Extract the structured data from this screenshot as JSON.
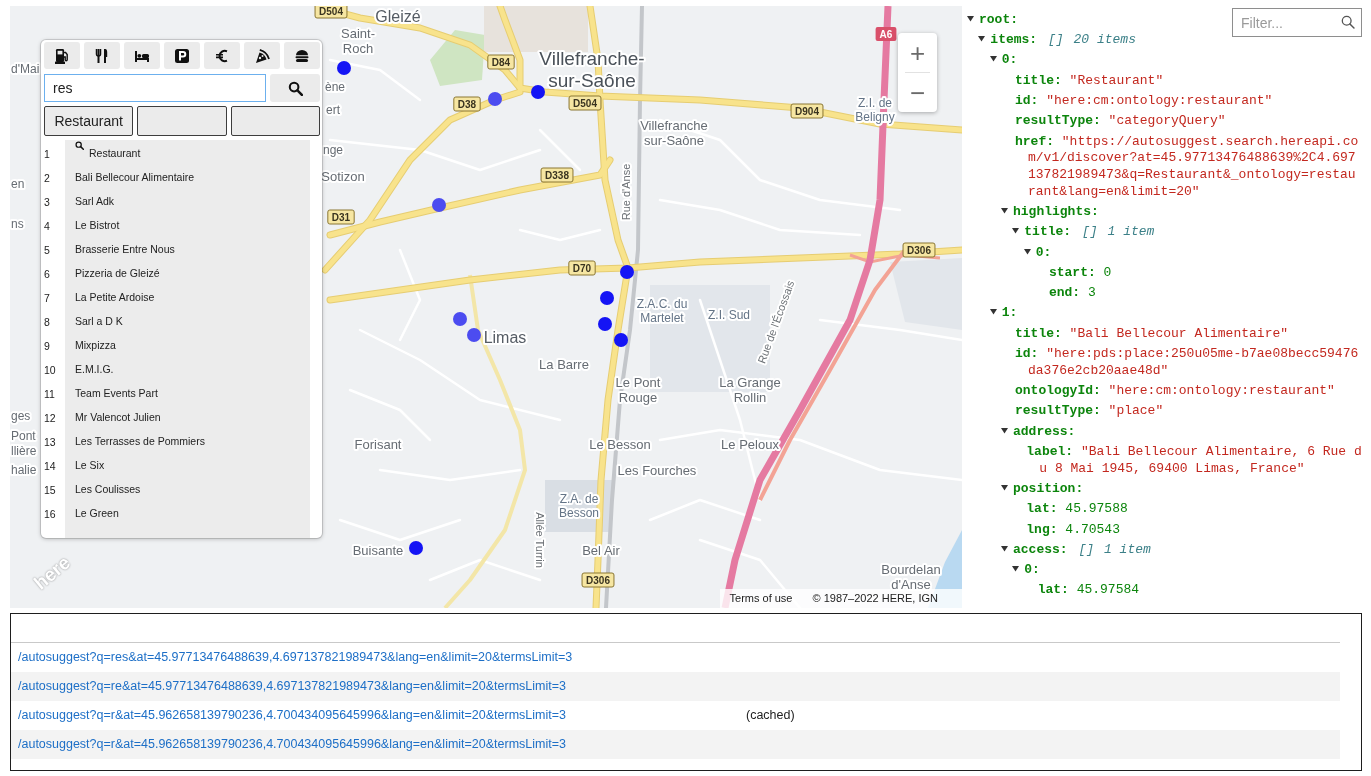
{
  "map": {
    "labels": [
      {
        "kind": "road",
        "lines": [
          "D504"
        ]
      },
      {
        "kind": "town",
        "lines": [
          "Gleizé"
        ]
      },
      {
        "kind": "place",
        "lines": [
          "Saint-",
          "Roch"
        ]
      },
      {
        "kind": "motorway",
        "lines": [
          "A6"
        ]
      },
      {
        "kind": "partial",
        "lines": [
          "d'Mai"
        ]
      },
      {
        "kind": "road",
        "lines": [
          "D84"
        ]
      },
      {
        "kind": "city",
        "lines": [
          "Villefranche-",
          "sur-Saône"
        ]
      },
      {
        "kind": "partial",
        "lines": [
          "ène"
        ]
      },
      {
        "kind": "partial",
        "lines": [
          "ert"
        ]
      },
      {
        "kind": "road",
        "lines": [
          "D38"
        ]
      },
      {
        "kind": "road",
        "lines": [
          "D504"
        ]
      },
      {
        "kind": "road",
        "lines": [
          "D904"
        ]
      },
      {
        "kind": "area",
        "lines": [
          "Z.I. de",
          "Beligny"
        ]
      },
      {
        "kind": "place",
        "lines": [
          "Villefranche",
          "sur-Saône"
        ]
      },
      {
        "kind": "partial",
        "lines": [
          "nge"
        ]
      },
      {
        "kind": "partial",
        "lines": [
          "en"
        ]
      },
      {
        "kind": "place",
        "lines": [
          "Sotizon"
        ]
      },
      {
        "kind": "road",
        "lines": [
          "D338"
        ]
      },
      {
        "kind": "street",
        "lines": [
          "Rue d'Anse"
        ]
      },
      {
        "kind": "partial",
        "lines": [
          "ns"
        ]
      },
      {
        "kind": "road",
        "lines": [
          "D31"
        ]
      },
      {
        "kind": "road",
        "lines": [
          "D306"
        ]
      },
      {
        "kind": "road",
        "lines": [
          "D70"
        ]
      },
      {
        "kind": "area",
        "lines": [
          "Z.A.C. du",
          "Martelet"
        ]
      },
      {
        "kind": "area",
        "lines": [
          "Z.I. Sud"
        ]
      },
      {
        "kind": "street",
        "lines": [
          "Rue de l'Écossais"
        ]
      },
      {
        "kind": "town",
        "lines": [
          "Limas"
        ]
      },
      {
        "kind": "place",
        "lines": [
          "La Barre"
        ]
      },
      {
        "kind": "place",
        "lines": [
          "Le Pont",
          "Rouge"
        ]
      },
      {
        "kind": "place",
        "lines": [
          "La Grange",
          "Rollin"
        ]
      },
      {
        "kind": "partial",
        "lines": [
          "ges"
        ]
      },
      {
        "kind": "partial",
        "lines": [
          "Pont"
        ]
      },
      {
        "kind": "partial",
        "lines": [
          "llière"
        ]
      },
      {
        "kind": "place",
        "lines": [
          "Forisant"
        ]
      },
      {
        "kind": "place",
        "lines": [
          "Le Besson"
        ]
      },
      {
        "kind": "place",
        "lines": [
          "Le Peloux"
        ]
      },
      {
        "kind": "partial",
        "lines": [
          "halie"
        ]
      },
      {
        "kind": "place",
        "lines": [
          "Les Fourches"
        ]
      },
      {
        "kind": "area",
        "lines": [
          "Z.A. de",
          "Besson"
        ]
      },
      {
        "kind": "street",
        "lines": [
          "Allée Turrin"
        ]
      },
      {
        "kind": "place",
        "lines": [
          "Buisante"
        ]
      },
      {
        "kind": "place",
        "lines": [
          "Bel Air"
        ]
      },
      {
        "kind": "road",
        "lines": [
          "D306"
        ]
      },
      {
        "kind": "place",
        "lines": [
          "Bourdelan",
          "d'Anse"
        ]
      }
    ],
    "zoom_controls": [
      "+",
      "−"
    ],
    "logo": "here",
    "attribution": {
      "terms": "Terms of use",
      "copyright": "© 1987–2022 HERE, IGN"
    }
  },
  "search_panel": {
    "search": {
      "value": "res",
      "focused": true
    },
    "suggestions": [
      {
        "kind": "term",
        "label": "Restaurant"
      },
      {
        "kind": "blank"
      },
      {
        "kind": "blank"
      }
    ],
    "results": [
      {
        "number": "1",
        "title": "Restaurant",
        "kind": "category"
      },
      {
        "number": "2",
        "title": "Bali Bellecour Alimentaire",
        "kind": "place"
      },
      {
        "number": "3",
        "title": "Sarl Adk",
        "kind": "place"
      },
      {
        "number": "4",
        "title": "Le Bistrot",
        "kind": "place"
      },
      {
        "number": "5",
        "title": "Brasserie Entre Nous",
        "kind": "place"
      },
      {
        "number": "6",
        "title": "Pizzeria de Gleizé",
        "kind": "place"
      },
      {
        "number": "7",
        "title": "La Petite Ardoise",
        "kind": "place"
      },
      {
        "number": "8",
        "title": "Sarl a D K",
        "kind": "place"
      },
      {
        "number": "9",
        "title": "Mixpizza",
        "kind": "place"
      },
      {
        "number": "10",
        "title": "E.M.I.G.",
        "kind": "place"
      },
      {
        "number": "11",
        "title": "Team Events Part",
        "kind": "place"
      },
      {
        "number": "12",
        "title": "Mr Valencot Julien",
        "kind": "place"
      },
      {
        "number": "13",
        "title": "Les Terrasses de Pommiers",
        "kind": "place"
      },
      {
        "number": "14",
        "title": "Le Six",
        "kind": "place"
      },
      {
        "number": "15",
        "title": "Les Coulisses",
        "kind": "place"
      },
      {
        "number": "16",
        "title": "Le Green",
        "kind": "place"
      }
    ]
  },
  "json_viewer": {
    "filter": {
      "placeholder": "Filter..."
    },
    "tree": [
      {
        "key": "root:",
        "expanded": true,
        "children": [
          {
            "key": "items:",
            "brackets": "[]",
            "count": "20 items",
            "expanded": true,
            "children": [
              {
                "key": "0:",
                "expanded": true,
                "children": [
                  {
                    "key": "title:",
                    "value": "\"Restaurant\"",
                    "kind": "string"
                  },
                  {
                    "key": "id:",
                    "value": "\"here:cm:ontology:restaurant\"",
                    "kind": "string"
                  },
                  {
                    "key": "resultType:",
                    "value": "\"categoryQuery\"",
                    "kind": "string"
                  },
                  {
                    "key": "href:",
                    "value": "\"https://autosuggest.search.hereapi.com/v1/discover?at=45.97713476488639%2C4.697137821989473&q=Restaurant&_ontology=restaurant&lang=en&limit=20\"",
                    "kind": "string"
                  },
                  {
                    "key": "highlights:",
                    "expanded": true,
                    "children": [
                      {
                        "key": "title:",
                        "brackets": "[]",
                        "count": "1 item",
                        "expanded": true,
                        "children": [
                          {
                            "key": "0:",
                            "expanded": true,
                            "children": [
                              {
                                "key": "start:",
                                "value": "0",
                                "kind": "number"
                              },
                              {
                                "key": "end:",
                                "value": "3",
                                "kind": "number"
                              }
                            ]
                          }
                        ]
                      }
                    ]
                  }
                ]
              },
              {
                "key": "1:",
                "expanded": true,
                "children": [
                  {
                    "key": "title:",
                    "value": "\"Bali Bellecour Alimentaire\"",
                    "kind": "string"
                  },
                  {
                    "key": "id:",
                    "value": "\"here:pds:place:250u05me-b7ae08becc59476da376e2cb20aae48d\"",
                    "kind": "string"
                  },
                  {
                    "key": "ontologyId:",
                    "value": "\"here:cm:ontology:restaurant\"",
                    "kind": "string"
                  },
                  {
                    "key": "resultType:",
                    "value": "\"place\"",
                    "kind": "string"
                  },
                  {
                    "key": "address:",
                    "expanded": true,
                    "children": [
                      {
                        "key": "label:",
                        "value": "\"Bali Bellecour Alimentaire, 6 Rue du 8 Mai 1945, 69400 Limas, France\"",
                        "kind": "string"
                      }
                    ]
                  },
                  {
                    "key": "position:",
                    "expanded": true,
                    "children": [
                      {
                        "key": "lat:",
                        "value": "45.97588",
                        "kind": "number"
                      },
                      {
                        "key": "lng:",
                        "value": "4.70543",
                        "kind": "number"
                      }
                    ]
                  },
                  {
                    "key": "access:",
                    "brackets": "[]",
                    "count": "1 item",
                    "expanded": true,
                    "children": [
                      {
                        "key": "0:",
                        "expanded": true,
                        "children": [
                          {
                            "key": "lat:",
                            "value": "45.97584",
                            "kind": "number"
                          }
                        ]
                      }
                    ]
                  }
                ]
              }
            ]
          }
        ]
      }
    ]
  },
  "request_log": [
    {
      "url": "/autosuggest?q=res&at=45.97713476488639,4.697137821989473&lang=en&limit=20&termsLimit=3"
    },
    {
      "url": "/autosuggest?q=re&at=45.97713476488639,4.697137821989473&lang=en&limit=20&termsLimit=3"
    },
    {
      "url": "/autosuggest?q=r&at=45.962658139790236,4.700434095645996&lang=en&limit=20&termsLimit=3",
      "note": "(cached)"
    },
    {
      "url": "/autosuggest?q=r&at=45.962658139790236,4.700434095645996&lang=en&limit=20&termsLimit=3"
    }
  ]
}
